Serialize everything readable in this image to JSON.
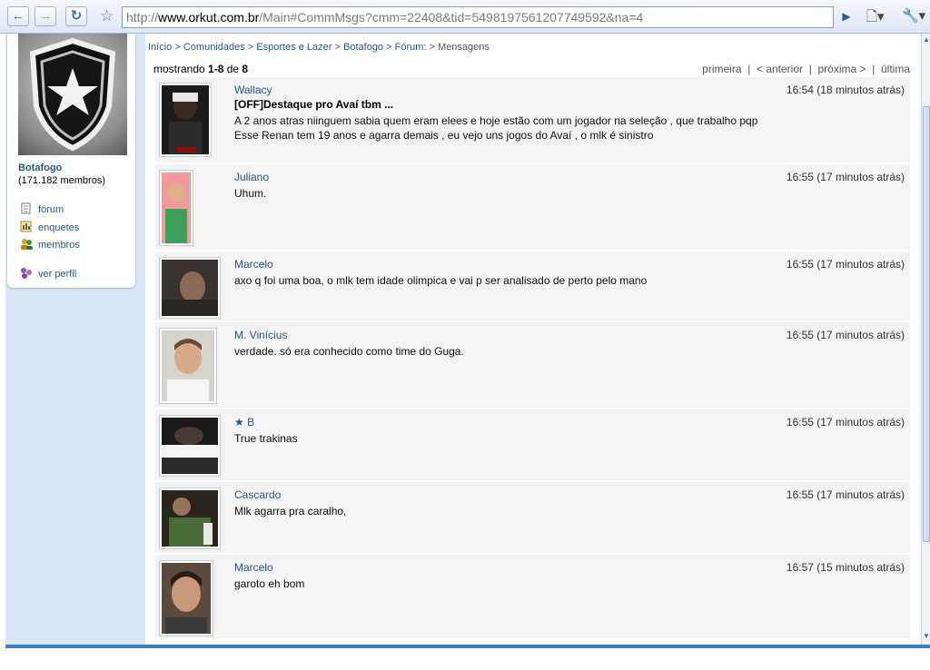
{
  "browser": {
    "url_scheme": "http://",
    "url_host": "www.orkut.com.br",
    "url_path": "/Main#CommMsgs?cmm=22408&tid=5498197561207749592&na=4"
  },
  "sidebar": {
    "community_name": "Botafogo",
    "member_count": "(171.182 membros)",
    "links": [
      {
        "label": "fórum",
        "icon": "forum-icon"
      },
      {
        "label": "enquetes",
        "icon": "poll-icon"
      },
      {
        "label": "membros",
        "icon": "members-icon"
      },
      {
        "label": "ver perfil",
        "icon": "profile-icon"
      }
    ]
  },
  "breadcrumb": {
    "items": [
      "Início",
      "Comunidades",
      "Esportes e Lazer",
      "Botafogo",
      "Fórum:"
    ],
    "current": "Mensagens",
    "separator": ">"
  },
  "listing": {
    "prefix": "mostrando ",
    "range": "1-8",
    "of": " de ",
    "total": "8"
  },
  "pager": {
    "first": "primeira",
    "prev": "< anterior",
    "next": "próxima >",
    "last": "última",
    "divider": "|"
  },
  "posts": [
    {
      "author": "Wallacy",
      "time": "16:54 (18 minutos atrás)",
      "subject": "[OFF]Destaque pro Avaí tbm ...",
      "body": "A 2 anos atras niinguem sabia quem eram elees e hoje estão com um jogador na seleção , que trabalho pqp\nEsse Renan tem 19 anos e agarra demais , eu vejo uns jogos do Avaí , o mlk é sinistro"
    },
    {
      "author": "Juliano",
      "time": "16:55 (17 minutos atrás)",
      "subject": "",
      "body": "Uhum."
    },
    {
      "author": "Marcelo",
      "time": "16:55 (17 minutos atrás)",
      "subject": "",
      "body": "axo q foi uma boa, o mlk tem idade olimpica e vai p ser analisado de perto pelo mano"
    },
    {
      "author": "M. Vinícius",
      "time": "16:55 (17 minutos atrás)",
      "subject": "",
      "body": "verdade. só era conhecido como time do Guga."
    },
    {
      "author": "★ B",
      "time": "16:55 (17 minutos atrás)",
      "subject": "",
      "body": "True trakinas"
    },
    {
      "author": "Cascardo",
      "time": "16:55 (17 minutos atrás)",
      "subject": "",
      "body": "Mlk agarra pra caralho,"
    },
    {
      "author": "Marcelo",
      "time": "16:57 (15 minutos atrás)",
      "subject": "",
      "body": "garoto eh bom"
    }
  ],
  "colors": {
    "link": "#2a5787",
    "post_background": "#f3f3f3",
    "sidebar_background": "#d8e6f5"
  }
}
